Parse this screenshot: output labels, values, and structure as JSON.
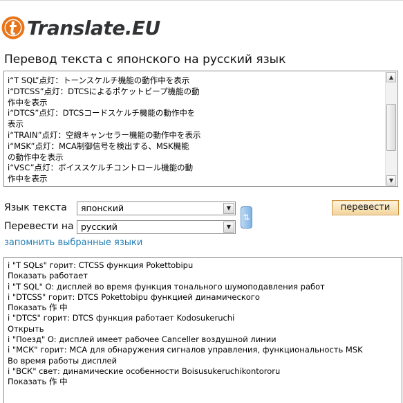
{
  "brand": {
    "name": "Translate.EU",
    "accent": "#e8751a"
  },
  "page": {
    "title": "Перевод текста с японского на русский язык"
  },
  "source": {
    "text": "i“T SQL”点灯：トーンスケルチ機能の動作中を表示\ni“DTCSS”点灯：DTCSによるポケットビープ機能の動\n作中を表示\ni“DTCS”点灯：DTCSコードスケルチ機能の動作中を\n表示\ni“TRAIN”点灯：空線キャンセラー機能の動作中を表示\ni“MSK”点灯：MCA制御信号を検出する、MSK機能\nの動作中を表示\ni“VSC”点灯：ボイススケルチコントロール機能の動\n作中を表示"
  },
  "controls": {
    "source_lang_label": "Язык текста",
    "source_lang_value": "японский",
    "target_lang_label": "Перевести на",
    "target_lang_value": "русский",
    "translate_label": "перевести",
    "remember_label": "запомнить выбранные языки",
    "swap_icon": "swap-languages-icon"
  },
  "result": {
    "text": "i \"T SQLs\" горит: CTCSS функция Pokettobipu\nПоказать работает\ni \"T SQL\" O: дисплей во время функция тонального шумоподавления работ\ni \"DTCSS\" горит: DTCS Pokettobipu функцией динамического\nПоказать 作 中\ni \"DTCS\" горит: DTCS функция работает Kodosukeruchi\nОткрыть\ni \"Поезд\" O: дисплей имеет рабочее Canceller воздушной линии\ni \"МСК\" горит: MCA для обнаружения сигналов управления, функциональность MSK\nВо время работы дисплей\ni \"ВСК\" свет: динамические особенности Boisusukeruchikontororu\nПоказать 作 中"
  }
}
